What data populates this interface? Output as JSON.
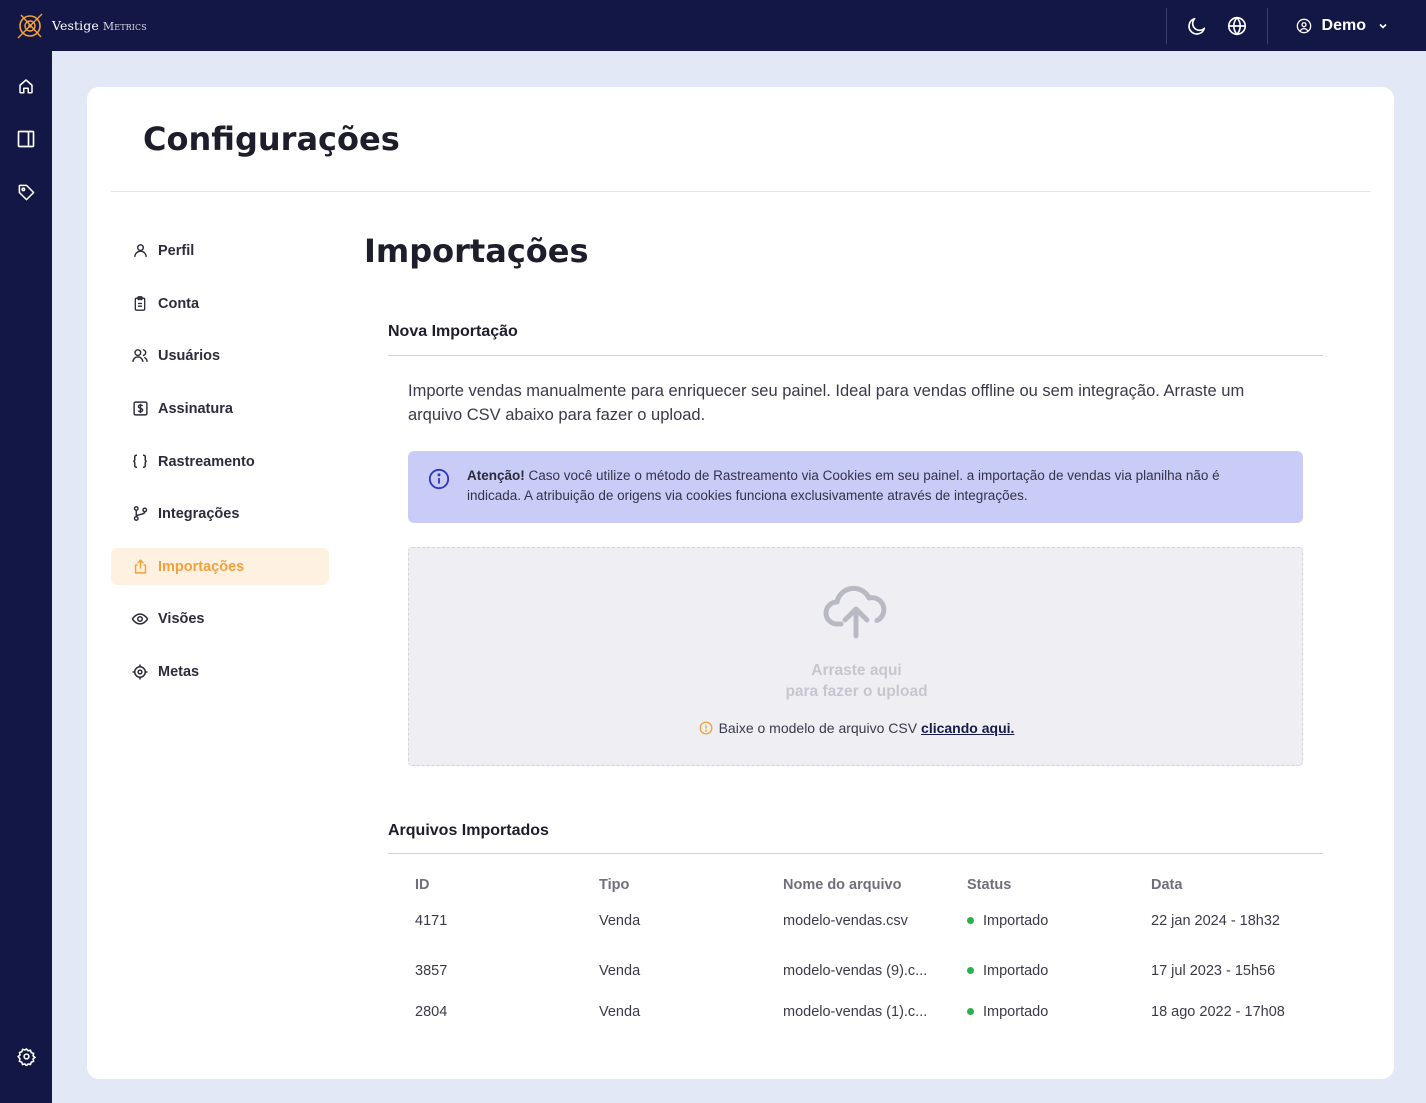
{
  "topbar": {
    "brand_main": "Vestige",
    "brand_sub": "Metrics",
    "user_name": "Demo"
  },
  "page": {
    "title": "Configurações"
  },
  "settings_nav": [
    {
      "label": "Perfil",
      "icon": "user-icon"
    },
    {
      "label": "Conta",
      "icon": "clipboard-icon"
    },
    {
      "label": "Usuários",
      "icon": "users-icon"
    },
    {
      "label": "Assinatura",
      "icon": "dollar-icon"
    },
    {
      "label": "Rastreamento",
      "icon": "braces-icon"
    },
    {
      "label": "Integrações",
      "icon": "git-branch-icon"
    },
    {
      "label": "Importações",
      "icon": "upload-icon",
      "active": true
    },
    {
      "label": "Visões",
      "icon": "eye-icon"
    },
    {
      "label": "Metas",
      "icon": "target-icon"
    }
  ],
  "content": {
    "title": "Importações",
    "new_import": {
      "heading": "Nova Importação",
      "description": "Importe vendas manualmente para enriquecer seu painel. Ideal para vendas offline ou sem integração. Arraste um arquivo CSV abaixo para fazer o upload.",
      "alert_strong": "Atenção!",
      "alert_text": " Caso você utilize o método de Rastreamento via Cookies em seu painel. a importação de vendas via planilha não é indicada. A atribuição de origens via cookies funciona exclusivamente através de integrações.",
      "drop_line1": "Arraste aqui",
      "drop_line2": "para fazer o upload",
      "help_text": "Baixe o modelo de arquivo CSV",
      "help_link": "clicando aqui."
    },
    "imported": {
      "heading": "Arquivos Importados",
      "columns": [
        "ID",
        "Tipo",
        "Nome do arquivo",
        "Status",
        "Data"
      ],
      "rows": [
        {
          "id": "4171",
          "tipo": "Venda",
          "nome": "modelo-vendas.csv",
          "status": "Importado",
          "data": "22 jan 2024 - 18h32"
        },
        {
          "id": "3857",
          "tipo": "Venda",
          "nome": "modelo-vendas (9).c...",
          "status": "Importado",
          "data": "17 jul 2023 - 15h56"
        },
        {
          "id": "2804",
          "tipo": "Venda",
          "nome": "modelo-vendas (1).c...",
          "status": "Importado",
          "data": "18 ago 2022 - 17h08"
        }
      ]
    }
  },
  "colors": {
    "navy": "#131745",
    "accent_orange": "#f2a13a",
    "alert_bg": "#c9ccf6",
    "status_green": "#2ab14a"
  }
}
